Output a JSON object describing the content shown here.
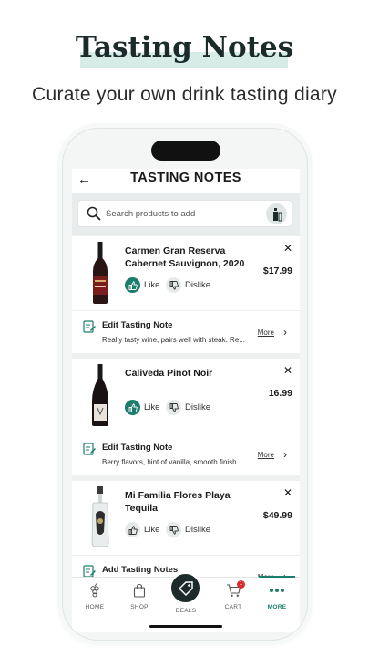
{
  "promo": {
    "title": "Tasting Notes",
    "subtitle": "Curate your own drink tasting diary"
  },
  "header": {
    "back_icon": "arrow-left-icon",
    "title": "TASTING NOTES"
  },
  "search": {
    "placeholder": "Search products to add",
    "scan_icon": "bottle-scan-icon"
  },
  "products": [
    {
      "name": "Carmen Gran Reserva Cabernet Sauvignon, 2020",
      "price": "$17.99",
      "like_label": "Like",
      "dislike_label": "Dislike",
      "liked": true,
      "note_title": "Edit Tasting Note",
      "note_text": "Really tasty wine, pairs well with steak. Re...",
      "more_label": "More"
    },
    {
      "name": "Caliveda Pinot Noir",
      "price": "16.99",
      "like_label": "Like",
      "dislike_label": "Dislike",
      "liked": true,
      "note_title": "Edit Tasting Note",
      "note_text": "Berry flavors, hint of vanilla, smooth finish....",
      "more_label": "More"
    },
    {
      "name": "Mi Familia Flores Playa Tequila",
      "price": "$49.99",
      "like_label": "Like",
      "dislike_label": "Dislike",
      "liked": false,
      "note_title": "Add Tasting Notes",
      "note_text": "",
      "more_label": "More"
    }
  ],
  "nav": {
    "home": "HOME",
    "shop": "SHOP",
    "deals": "DEALS",
    "cart": "CART",
    "cart_count": "1",
    "more": "MORE"
  },
  "colors": {
    "accent": "#1d7d6d",
    "dark": "#1d2a2a",
    "badge": "#d32f2f"
  }
}
